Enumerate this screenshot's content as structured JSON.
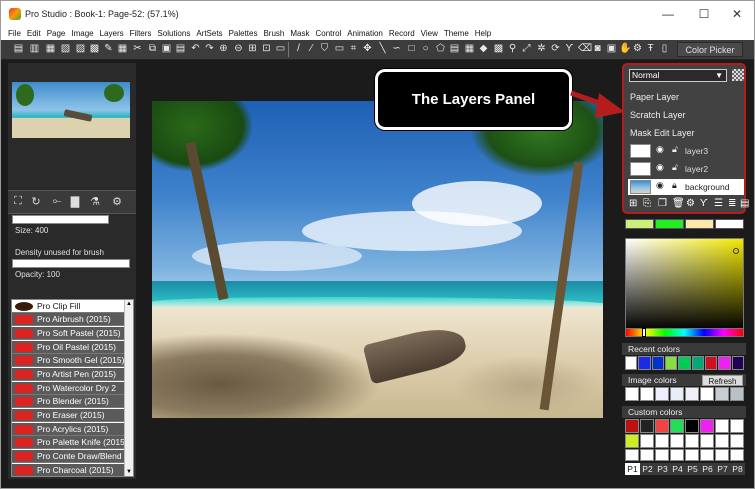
{
  "window": {
    "title": "Pro Studio : Book-1: Page-52:  (57.1%)",
    "minimize": "—",
    "maximize": "☐",
    "close": "✕"
  },
  "menu": [
    "File",
    "Edit",
    "Page",
    "Image",
    "Layers",
    "Filters",
    "Solutions",
    "ArtSets",
    "Palettes",
    "Brush",
    "Mask",
    "Control",
    "Animation",
    "Record",
    "View",
    "Theme",
    "Help"
  ],
  "toolbar": {
    "color_picker_label": "Color Picker"
  },
  "left_panel": {
    "size_label": "Size: 400",
    "density_label": "Density unused for brush",
    "opacity_label": "Opacity: 100"
  },
  "brushes": [
    "Pro Clip Fill",
    "Pro Airbrush (2015)",
    "Pro Soft Pastel (2015)",
    "Pro Oil Pastel (2015)",
    "Pro Smooth Gel (2015)",
    "Pro Artist Pen (2015)",
    "Pro Watercolor Dry 2",
    "Pro Blender (2015)",
    "Pro Eraser (2015)",
    "Pro Acrylics (2015)",
    "Pro Palette Knife (2015)",
    "Pro Conte Draw/Blend",
    "Pro Charcoal (2015)"
  ],
  "layers_panel": {
    "blend_mode": "Normal",
    "menu_items": [
      "Paper Layer",
      "Scratch Layer",
      "Mask Edit Layer"
    ],
    "layers": [
      {
        "name": "layer3"
      },
      {
        "name": "layer2"
      },
      {
        "name": "background"
      }
    ]
  },
  "colors": {
    "recent_label": "Recent colors",
    "image_label": "Image colors",
    "refresh_label": "Refresh",
    "custom_label": "Custom colors",
    "recent": [
      "#ffffff",
      "#1a2be8",
      "#0033cc",
      "#88dd44",
      "#00cc55",
      "#00aa77",
      "#cc1122",
      "#ee22ee",
      "#220055"
    ],
    "image": [
      "#ffffff",
      "#ffffff",
      "#eeeeff",
      "#e8eef6",
      "#f0f0f8",
      "#ffffff",
      "#c8ccd4",
      "#b8c0c8"
    ],
    "custom": [
      "#bb1111",
      "#222222",
      "#ee4444",
      "#22dd55",
      "#000000",
      "#ee22ee",
      "#ffffff",
      "#ffffff",
      "#ccee22",
      "#ffffff",
      "#ffffff",
      "#ffffff",
      "#ffffff",
      "#ffffff",
      "#ffffff",
      "#ffffff"
    ],
    "palette_tabs": [
      "P1",
      "P2",
      "P3",
      "P4",
      "P5",
      "P6",
      "P7",
      "P8"
    ]
  },
  "callout": {
    "text": "The Layers Panel"
  },
  "accent": "#b31d1d"
}
